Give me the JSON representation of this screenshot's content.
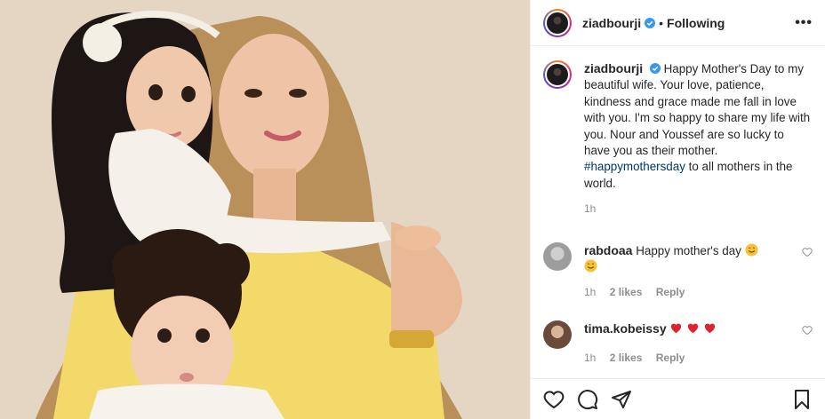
{
  "header": {
    "username": "ziadbourji",
    "separator": "•",
    "follow_state": "Following",
    "more": "•••"
  },
  "caption": {
    "username": "ziadbourji",
    "text": "Happy Mother's Day to my beautiful wife. Your love, patience, kindness and grace made me fall in love with you. I'm so happy to share my life with you. Nour and Youssef are so lucky to have you as their mother.",
    "hashtag": "#happymothersday",
    "text_after": "to all mothers in the world.",
    "time": "1h"
  },
  "comments": [
    {
      "username": "rabdoaa",
      "text": "Happy mother's day",
      "time": "1h",
      "likes": "2 likes",
      "reply": "Reply",
      "emojis": "smiling-face-with-hearts x2"
    },
    {
      "username": "tima.kobeissy",
      "text": "",
      "time": "1h",
      "likes": "2 likes",
      "reply": "Reply",
      "emojis": "red-heart x3"
    }
  ],
  "colors": {
    "accent": "#0095f6",
    "hashtag": "#00376b",
    "muted": "#8e8e8e",
    "heart": "#ed4956"
  }
}
